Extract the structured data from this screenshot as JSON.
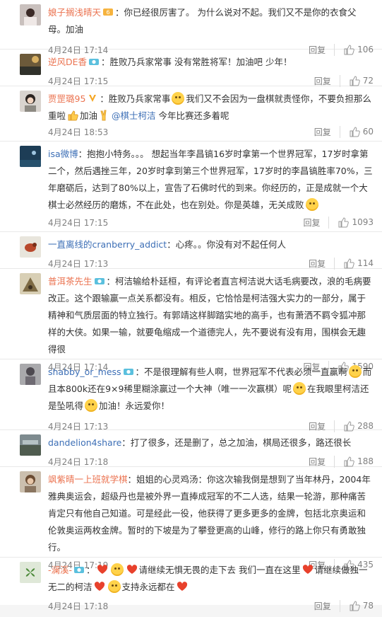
{
  "comments": [
    {
      "name": "娘子搁浅晴天",
      "text": "：你已经很厉害了。  为什么说对不起。我们又不是你的衣食父母。加油",
      "time": "4月24日 17:14",
      "reply": "回复",
      "likes": "106"
    },
    {
      "name": "逆风DE香",
      "text": "：胜败乃兵家常事 没有常胜将军！加油吧 少年！",
      "time": "4月24日 17:15",
      "reply": "回复",
      "likes": "72"
    },
    {
      "name": "贾罡璐95",
      "text_1": "：胜败乃兵家常事",
      "text_2": "我们又不会因为一盘棋就责怪你，不要负担那么重啦",
      "text_3": "加油",
      "link": "@棋士柯洁",
      "text_4": " 今年比赛还多着呢",
      "time": "4月24日 18:53",
      "reply": "回复",
      "likes": "60"
    },
    {
      "name": "isa微博",
      "text": "：抱抱小特务。。。 想起当年李昌镐16岁时拿第一个世界冠军，17岁时拿第二个，然后遇挫三年，20岁时拿到第三个世界冠军，17岁时的李昌镐胜率70%，三年磨砺后，达到了80%以上，宣告了石佛时代的到来。你经历的，正是成就一个大棋士必然经历的磨炼，不在此处，也在别处。你是英雄，无关成败",
      "time": "4月24日 17:15",
      "reply": "回复",
      "likes": "1093"
    },
    {
      "name": "一直离线的cranberry_addict",
      "text": "：心疼。。你没有对不起任何人",
      "time": "4月24日 17:13",
      "reply": "回复",
      "likes": "114"
    },
    {
      "name": "普洱茶先生",
      "text": "：柯洁输给朴廷桓，有评论者直言柯洁说大话毛病要改，浪的毛病要改正。这个跟输赢一点关系都没有。相反，它恰恰是柯洁强大实力的一部分，属于精神和气质层面的特立独行。有郭靖这样脚踏实地的高手，也有萧洒不羁令狐冲那样的大侠。如果一输，就要龟缩成一个道德完人，先不要说有没有用，围棋会无趣得很",
      "time": "4月24日 17:14",
      "reply": "回复",
      "likes": "1590"
    },
    {
      "name": "shabby_or_mess",
      "text_1": "：不是很理解有些人啊，世界冠军不代表必须一直赢啊",
      "text_2": "而且本800k还在9×9稀里糊涂赢过一个大神（唯一一次赢棋）呢",
      "text_3": "在我眼里柯洁还是坠吼得",
      "text_4": "加油！永远爱你！",
      "time": "4月24日 17:13",
      "reply": "回复",
      "likes": "288"
    },
    {
      "name": "dandelion4share",
      "text": "：打了很多，还是删了，总之加油，棋局还很多，路还很长",
      "time": "4月24日 17:18",
      "reply": "回复",
      "likes": "188"
    },
    {
      "name": "飒紫晴一上班就学棋",
      "text": "：姐姐的心灵鸡汤：你这次输我倒是想到了当年林丹，2004年雅典奥运会，超级丹也是被外界一直捧成冠军的不二人选，结果一轮游，那种痛苦肯定只有他自己知道。可是经此一役，他获得了更多更多的金牌，包括北京奥运和伦敦奥运两枚金牌。暂时的下坡是为了攀登更高的山峰，修行的路上你只有勇敢独行。",
      "time": "4月24日 17:19",
      "reply": "回复",
      "likes": "435"
    },
    {
      "name": "-澜溪-",
      "text_1": "：",
      "text_2": "请继续无惧无畏的走下去 我们一直在这里",
      "text_3": "请继续做独一无二的柯洁",
      "text_4": "支持永远都在",
      "time": "4月24日 17:18",
      "reply": "回复",
      "likes": "78"
    }
  ]
}
